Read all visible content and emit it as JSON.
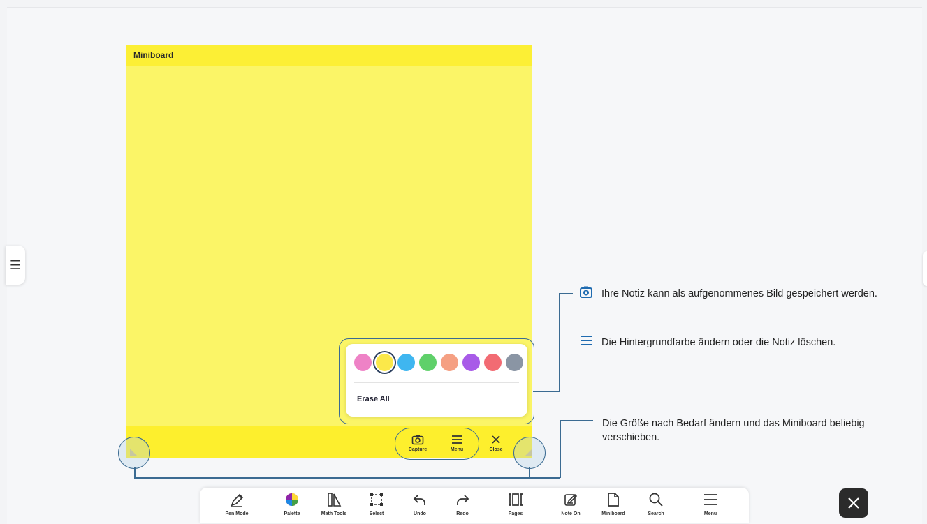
{
  "miniboard": {
    "title": "Miniboard",
    "background_color": "#fbf567",
    "popup": {
      "colors": [
        "#ee82c6",
        "#fbe84a",
        "#3fb6f0",
        "#5fd06a",
        "#f5a083",
        "#a85be8",
        "#f26b73",
        "#8a95a4"
      ],
      "selected_color_index": 1,
      "erase_label": "Erase All"
    },
    "controls": {
      "capture_label": "Capture",
      "menu_label": "Menu",
      "close_label": "Close"
    }
  },
  "callouts": {
    "capture_text": "Ihre Notiz kann als aufgenommenes Bild gespeichert werden.",
    "menu_text": "Die Hintergrundfarbe ändern oder die Notiz löschen.",
    "resize_text_line1": "Die Größe nach Bedarf ändern und das Miniboard beliebig",
    "resize_text_line2": "verschieben."
  },
  "toolbar": {
    "items": [
      {
        "label": "Pen Mode",
        "icon": "pen-icon"
      },
      {
        "label": "Palette",
        "icon": "palette-icon"
      },
      {
        "label": "Math Tools",
        "icon": "math-tools-icon"
      },
      {
        "label": "Select",
        "icon": "select-icon"
      },
      {
        "label": "Undo",
        "icon": "undo-icon"
      },
      {
        "label": "Redo",
        "icon": "redo-icon"
      },
      {
        "label": "Pages",
        "icon": "pages-icon"
      },
      {
        "label": "Note On",
        "icon": "note-on-icon"
      },
      {
        "label": "Miniboard",
        "icon": "miniboard-icon",
        "active": true
      },
      {
        "label": "Search",
        "icon": "search-icon"
      },
      {
        "label": "Menu",
        "icon": "menu-icon"
      }
    ]
  },
  "accent_color": "#3b6b92"
}
